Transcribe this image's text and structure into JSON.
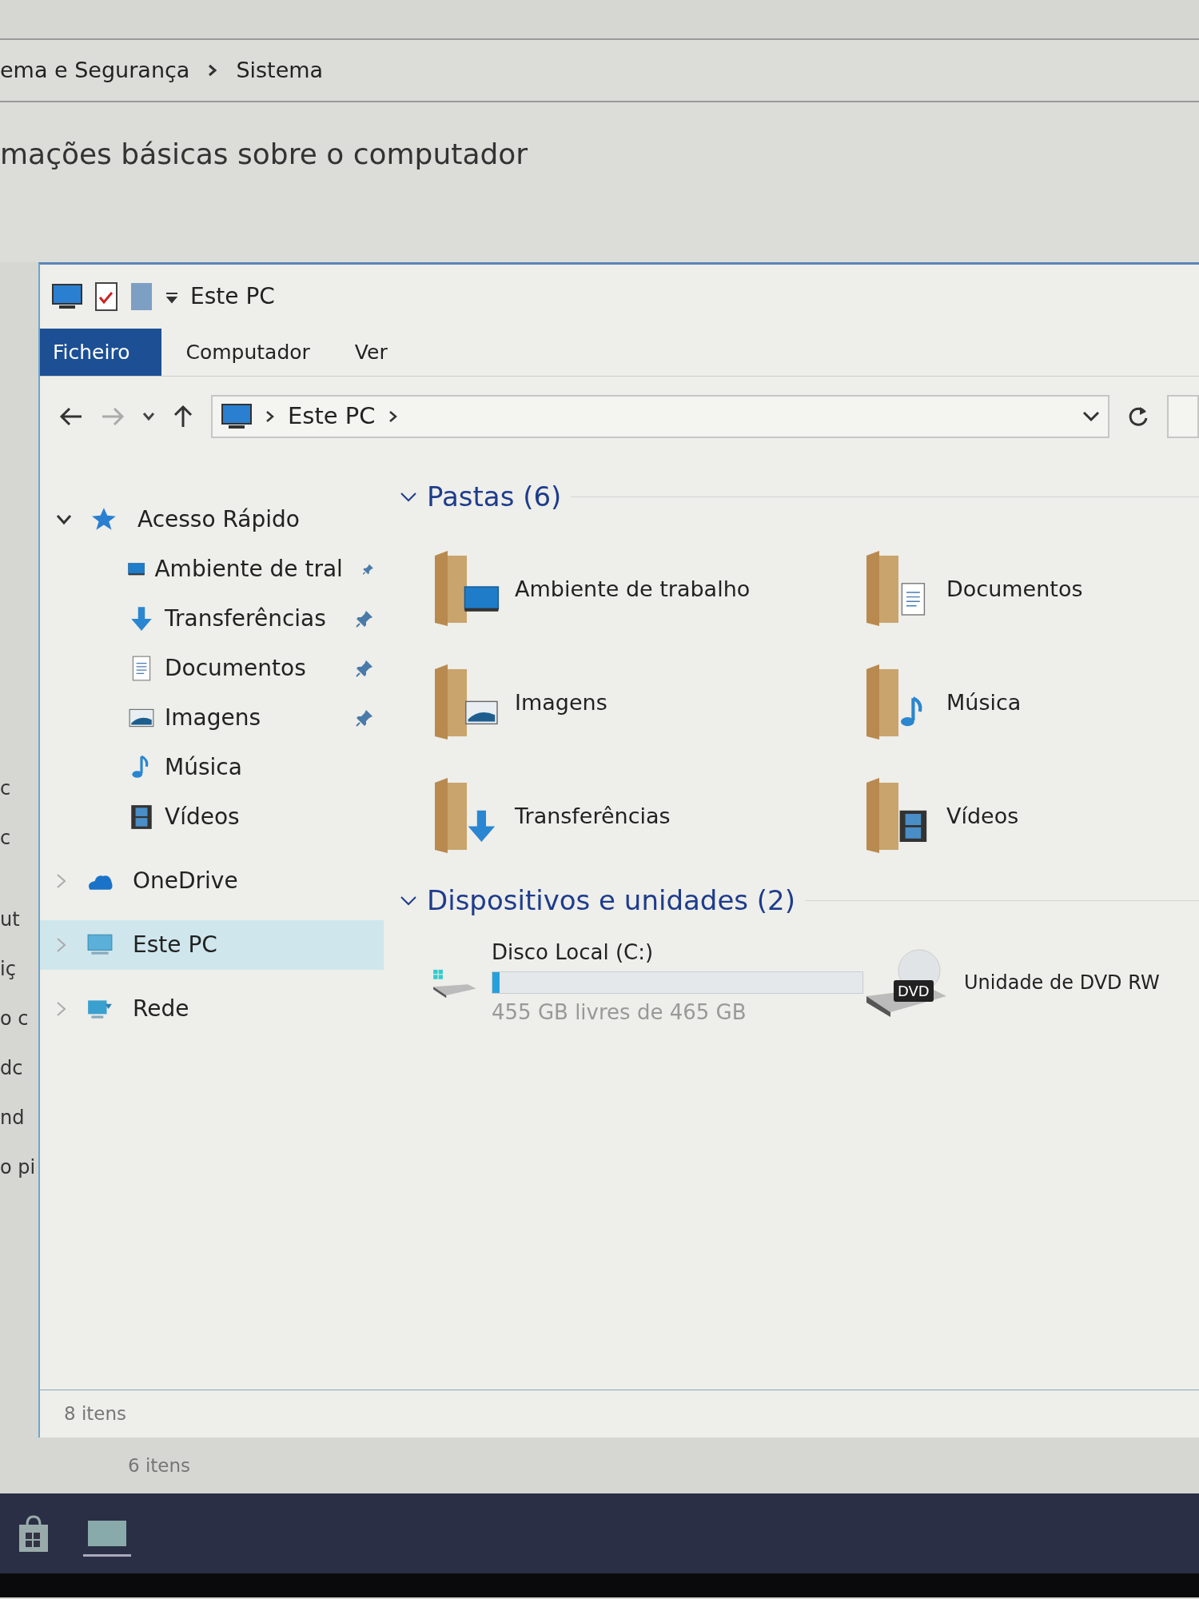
{
  "background_window": {
    "breadcrumb": [
      "ema e Segurança",
      "Sistema"
    ],
    "heading": "mações básicas sobre o computador",
    "fragments": [
      "c",
      "c",
      "ut",
      "iç",
      "o c",
      "dc",
      "nd",
      "o pi"
    ],
    "status": "6 itens"
  },
  "explorer": {
    "title": "Este PC",
    "ribbon_tabs": [
      {
        "label": "Ficheiro",
        "selected": true
      },
      {
        "label": "Computador",
        "selected": false
      },
      {
        "label": "Ver",
        "selected": false
      }
    ],
    "address": [
      "Este PC"
    ],
    "nav": [
      {
        "label": "Acesso Rápido",
        "expanded": true,
        "selected": false,
        "children": [
          {
            "label": "Ambiente de tral",
            "pinned": true,
            "selected": false
          },
          {
            "label": "Transferências",
            "pinned": true,
            "selected": false
          },
          {
            "label": "Documentos",
            "pinned": true,
            "selected": false
          },
          {
            "label": "Imagens",
            "pinned": true,
            "selected": false
          },
          {
            "label": "Música",
            "pinned": false,
            "selected": false
          },
          {
            "label": "Vídeos",
            "pinned": false,
            "selected": false
          }
        ]
      },
      {
        "label": "OneDrive",
        "expanded": false,
        "selected": false
      },
      {
        "label": "Este PC",
        "expanded": false,
        "selected": true
      },
      {
        "label": "Rede",
        "expanded": false,
        "selected": false
      }
    ],
    "folders_group": {
      "title": "Pastas (6)",
      "expanded": true,
      "items": [
        {
          "label": "Ambiente de trabalho"
        },
        {
          "label": "Documentos"
        },
        {
          "label": "Imagens"
        },
        {
          "label": "Música"
        },
        {
          "label": "Transferências"
        },
        {
          "label": "Vídeos"
        }
      ]
    },
    "devices_group": {
      "title": "Dispositivos e unidades (2)",
      "expanded": true,
      "items": [
        {
          "kind": "disk",
          "label": "Disco Local (C:)",
          "level": 0.02,
          "detail": "455 GB livres de 465 GB"
        },
        {
          "kind": "dvd",
          "label": "Unidade de DVD RW",
          "badge": "DVD"
        }
      ]
    },
    "status": "8 itens"
  }
}
